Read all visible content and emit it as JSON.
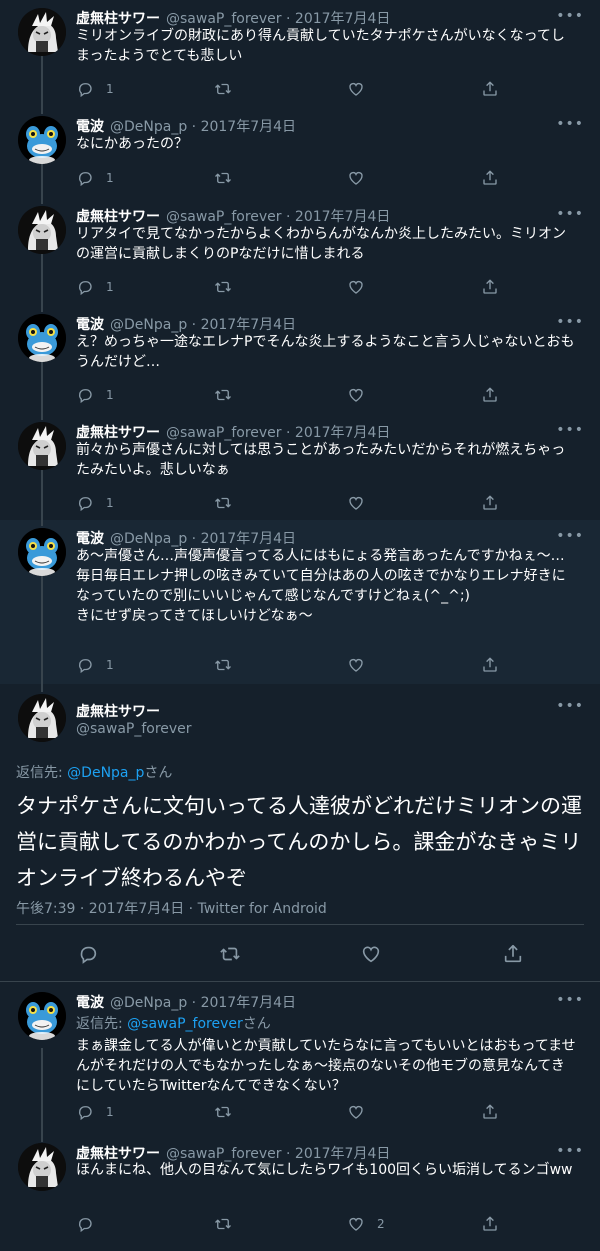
{
  "users": {
    "sawa": {
      "name": "虚無柱サワー",
      "handle": "@sawaP_forever"
    },
    "denpa": {
      "name": "電波",
      "handle": "@DeNpa_p"
    }
  },
  "icons": {
    "reply": "reply-icon",
    "retweet": "retweet-icon",
    "like": "heart-icon",
    "share": "share-icon",
    "more": "more-icon"
  },
  "colors": {
    "background": "#15202b",
    "highlight": "#192734",
    "muted": "#8899a6",
    "link": "#1da1f2",
    "divider": "#38444d"
  },
  "tweets": [
    {
      "name": "虚無柱サワー",
      "handle": "@sawaP_forever",
      "date": "· 2017年7月4日",
      "text": "ミリオンライブの財政にあり得ん貢献していたタナポケさんがいなくなってしまったようでとても悲しい",
      "reply_count": "1",
      "like_count": ""
    },
    {
      "name": "電波",
      "handle": "@DeNpa_p",
      "date": "· 2017年7月4日",
      "text": "なにかあったの？",
      "reply_count": "1",
      "like_count": ""
    },
    {
      "name": "虚無柱サワー",
      "handle": "@sawaP_forever",
      "date": "· 2017年7月4日",
      "text": "リアタイで見てなかったからよくわからんがなんか炎上したみたい。ミリオンの運営に貢献しまくりのPなだけに惜しまれる",
      "reply_count": "1",
      "like_count": ""
    },
    {
      "name": "電波",
      "handle": "@DeNpa_p",
      "date": "· 2017年7月4日",
      "text": "え？めっちゃ一途なエレナPでそんな炎上するようなこと言う人じゃないとおもうんだけど…",
      "reply_count": "1",
      "like_count": ""
    },
    {
      "name": "虚無柱サワー",
      "handle": "@sawaP_forever",
      "date": "· 2017年7月4日",
      "text": "前々から声優さんに対しては思うことがあったみたいだからそれが燃えちゃったみたいよ。悲しいなぁ",
      "reply_count": "1",
      "like_count": ""
    },
    {
      "name": "電波",
      "handle": "@DeNpa_p",
      "date": "· 2017年7月4日",
      "text": "あ〜声優さん…声優声優言ってる人にはもにょる発言あったんですかねぇ〜…\n毎日毎日エレナ押しの呟きみていて自分はあの人の呟きでかなりエレナ好きになっていたので別にいいじゃんて感じなんですけどねぇ(^_^;)\nきにせず戻ってきてほしいけどなぁ〜",
      "reply_count": "1",
      "like_count": ""
    }
  ],
  "focus": {
    "name": "虚無柱サワー",
    "handle": "@sawaP_forever",
    "reply_prefix": "返信先: ",
    "reply_target": "@DeNpa_p",
    "reply_suffix": "さん",
    "text": "タナポケさんに文句いってる人達彼がどれだけミリオンの運営に貢献してるのかわかってんのかしら。課金がなきゃミリオンライブ終わるんやぞ",
    "meta": "午後7:39 · 2017年7月4日 · Twitter for Android"
  },
  "replies": [
    {
      "name": "電波",
      "handle": "@DeNpa_p",
      "date": "· 2017年7月4日",
      "reply_prefix": "返信先: ",
      "reply_target": "@sawaP_forever",
      "reply_suffix": "さん",
      "text": "まぁ課金してる人が偉いとか貢献していたらなに言ってもいいとはおもってませんがそれだけの人でもなかったしなぁ〜接点のないその他モブの意見なんてきにしていたらTwitterなんてできなくない？",
      "reply_count": "1",
      "like_count": ""
    },
    {
      "name": "虚無柱サワー",
      "handle": "@sawaP_forever",
      "date": "· 2017年7月4日",
      "reply_prefix": "",
      "reply_target": "",
      "reply_suffix": "",
      "text": "ほんまにね、他人の目なんて気にしたらワイも100回くらい垢消してるンゴww",
      "reply_count": "",
      "like_count": "2"
    }
  ]
}
